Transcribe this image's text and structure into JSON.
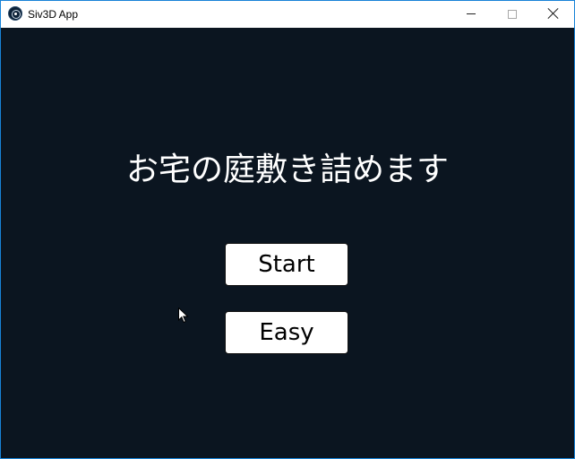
{
  "window": {
    "title": "Siv3D App",
    "icons": {
      "app": "siv3d-app-icon",
      "minimize": "minimize-icon",
      "maximize": "maximize-icon",
      "close": "close-icon"
    }
  },
  "game": {
    "title": "お宅の庭敷き詰めます",
    "buttons": {
      "start_label": "Start",
      "easy_label": "Easy"
    }
  },
  "colors": {
    "background": "#0b1520",
    "text": "#ffffff",
    "button_fill": "#ffffff",
    "button_text": "#000000",
    "window_border": "#1883d7"
  }
}
